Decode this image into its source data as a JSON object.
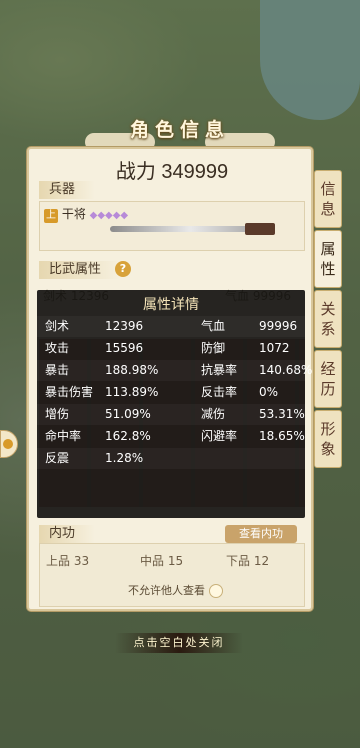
{
  "header": {
    "title": "角色信息"
  },
  "power": {
    "label": "战力",
    "value": "349999"
  },
  "weapon": {
    "section_label": "兵器",
    "rank_tag": "上",
    "name": "干将",
    "stars": "◆◆◆◆◆"
  },
  "biwu": {
    "section_label": "比武属性",
    "help_icon": "?"
  },
  "background_row": {
    "a_label": "剑术",
    "a_value": "12396",
    "b_label": "气血",
    "b_value": "99996"
  },
  "detail": {
    "title": "属性详情",
    "rows": [
      {
        "l1": "剑术",
        "v1": "12396",
        "l2": "气血",
        "v2": "99996"
      },
      {
        "l1": "攻击",
        "v1": "15596",
        "l2": "防御",
        "v2": "1072"
      },
      {
        "l1": "暴击",
        "v1": "188.98%",
        "l2": "抗暴率",
        "v2": "140.68%"
      },
      {
        "l1": "暴击伤害",
        "v1": "113.89%",
        "l2": "反击率",
        "v2": "0%"
      },
      {
        "l1": "增伤",
        "v1": "51.09%",
        "l2": "减伤",
        "v2": "53.31%"
      },
      {
        "l1": "命中率",
        "v1": "162.8%",
        "l2": "闪避率",
        "v2": "18.65%"
      },
      {
        "l1": "反震",
        "v1": "1.28%",
        "l2": "",
        "v2": ""
      }
    ]
  },
  "neigong": {
    "section_label": "内功",
    "view_button": "查看内功",
    "grades": [
      {
        "label": "上品",
        "count": "33"
      },
      {
        "label": "中品",
        "count": "15"
      },
      {
        "label": "下品",
        "count": "12"
      }
    ],
    "permission_text": "不允许他人查看"
  },
  "tabs": [
    {
      "label": "信息"
    },
    {
      "label": "属性"
    },
    {
      "label": "关系"
    },
    {
      "label": "经历"
    },
    {
      "label": "形象"
    }
  ],
  "close_hint": "点击空白处关闭",
  "colors": {
    "panel": "#f6f0de",
    "overlay": "#141210",
    "accent": "#c9a36a"
  }
}
